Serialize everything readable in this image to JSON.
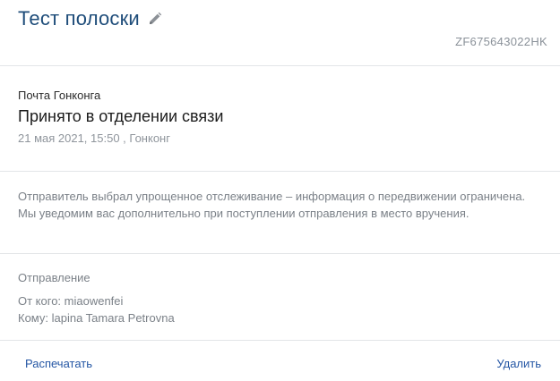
{
  "header": {
    "title": "Тест полоски",
    "track_number": "ZF675643022HK",
    "edit_icon": "pencil-icon"
  },
  "status": {
    "operator": "Почта Гонконга",
    "main": "Принято в отделении связи",
    "datetime_location": "21 мая 2021, 15:50 , Гонконг"
  },
  "notice": {
    "text": "Отправитель выбрал упрощенное отслеживание – информация о передвижении ограничена. Мы уведомим вас дополнительно при поступлении отправления в место вручения."
  },
  "shipment": {
    "title": "Отправление",
    "from": "От кого: miaowenfei",
    "to": "Кому: lapina Tamara Petrovna"
  },
  "footer": {
    "print_label": "Распечатать",
    "delete_label": "Удалить"
  },
  "colors": {
    "title": "#1f4d7a",
    "link": "#2456a4",
    "muted_text": "#7b8188",
    "divider": "#e3e5e8"
  }
}
